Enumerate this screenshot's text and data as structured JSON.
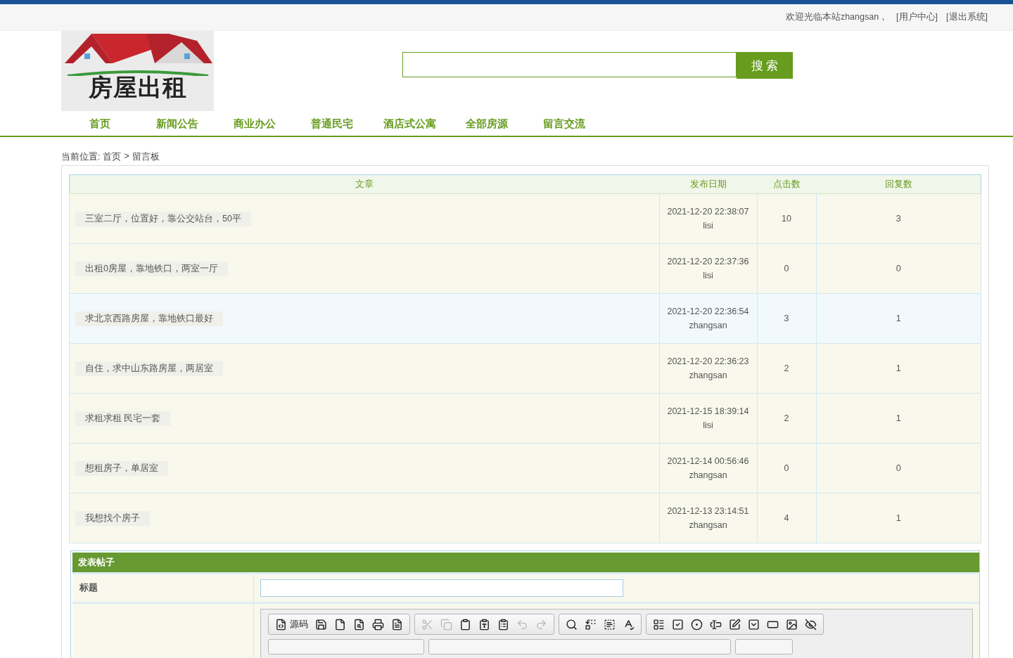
{
  "top_bar": {
    "welcome": "欢迎光临本站zhangsan，",
    "links": [
      "[用户中心]",
      "[退出系统]"
    ]
  },
  "logo": {
    "text": "房屋出租"
  },
  "search": {
    "button": "搜 索"
  },
  "nav": [
    {
      "label": "首页"
    },
    {
      "label": "新闻公告"
    },
    {
      "label": "商业办公"
    },
    {
      "label": "普通民宅"
    },
    {
      "label": "酒店式公寓"
    },
    {
      "label": "全部房源"
    },
    {
      "label": "留言交流"
    }
  ],
  "breadcrumb": {
    "prefix": "当前位置:",
    "items": [
      "首页",
      "留言板"
    ],
    "separator": ">"
  },
  "table": {
    "columns": [
      "文章",
      "发布日期",
      "点击数",
      "回复数"
    ],
    "rows": [
      {
        "title": "三室二厅，位置好，靠公交站台，50平",
        "date": "2021-12-20 22:38:07",
        "author": "lisi",
        "clicks": "10",
        "replies": "3",
        "highlighted": false
      },
      {
        "title": "出租0房屋，靠地铁口，两室一厅",
        "date": "2021-12-20 22:37:36",
        "author": "lisi",
        "clicks": "0",
        "replies": "0",
        "highlighted": false
      },
      {
        "title": "求北京西路房屋，靠地铁口最好",
        "date": "2021-12-20 22:36:54",
        "author": "zhangsan",
        "clicks": "3",
        "replies": "1",
        "highlighted": true
      },
      {
        "title": "自住，求中山东路房屋，两居室",
        "date": "2021-12-20 22:36:23",
        "author": "zhangsan",
        "clicks": "2",
        "replies": "1",
        "highlighted": false
      },
      {
        "title": "求租求租 民宅一套",
        "date": "2021-12-15 18:39:14",
        "author": "lisi",
        "clicks": "2",
        "replies": "1",
        "highlighted": false
      },
      {
        "title": "想租房子，单居室",
        "date": "2021-12-14 00:56:46",
        "author": "zhangsan",
        "clicks": "0",
        "replies": "0",
        "highlighted": false
      },
      {
        "title": "我想找个房子",
        "date": "2021-12-13 23:14:51",
        "author": "zhangsan",
        "clicks": "4",
        "replies": "1",
        "highlighted": false
      }
    ]
  },
  "post_form": {
    "heading": "发表帖子",
    "title_label": "标题",
    "toolbar": [
      [
        {
          "kind": "source",
          "label": "源码",
          "disabled": false
        },
        {
          "kind": "save",
          "disabled": false
        },
        {
          "kind": "newpage",
          "disabled": false
        },
        {
          "kind": "preview",
          "disabled": false
        },
        {
          "kind": "print",
          "disabled": false
        },
        {
          "kind": "templates",
          "disabled": false
        }
      ],
      [
        {
          "kind": "cut",
          "disabled": true
        },
        {
          "kind": "copy",
          "disabled": true
        },
        {
          "kind": "paste",
          "disabled": false
        },
        {
          "kind": "pastetext",
          "disabled": false
        },
        {
          "kind": "pasteword",
          "disabled": false
        },
        {
          "kind": "undo",
          "disabled": true
        },
        {
          "kind": "redo",
          "disabled": true
        }
      ],
      [
        {
          "kind": "find",
          "disabled": false
        },
        {
          "kind": "replace",
          "disabled": false
        },
        {
          "kind": "selectall",
          "disabled": false
        },
        {
          "kind": "spellcheck",
          "disabled": false
        }
      ],
      [
        {
          "kind": "form",
          "disabled": false
        },
        {
          "kind": "checkbox",
          "disabled": false
        },
        {
          "kind": "radio",
          "disabled": false
        },
        {
          "kind": "textfield",
          "disabled": false
        },
        {
          "kind": "textarea",
          "disabled": false
        },
        {
          "kind": "select",
          "disabled": false
        },
        {
          "kind": "button",
          "disabled": false
        },
        {
          "kind": "imagebutton",
          "disabled": false
        },
        {
          "kind": "hiddenfield",
          "disabled": false
        }
      ]
    ]
  }
}
